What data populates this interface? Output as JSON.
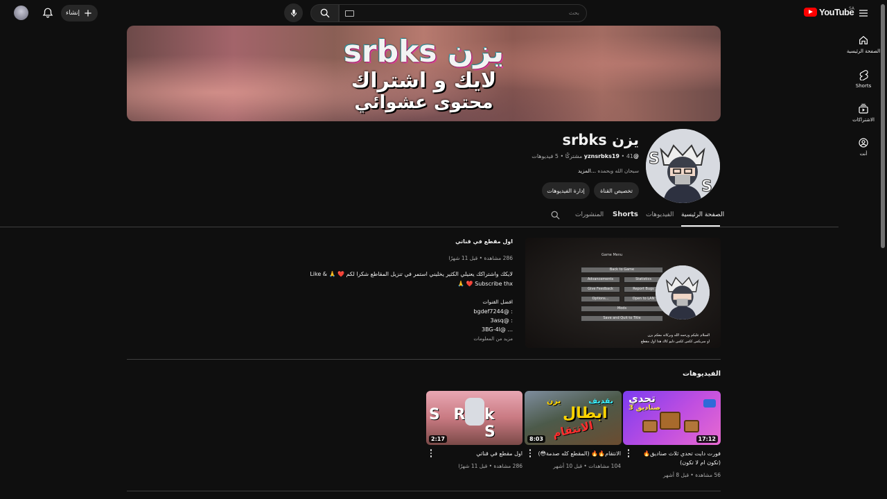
{
  "topbar": {
    "logo_text": "YouTube",
    "region": "SA",
    "search_placeholder": "بحث",
    "create_label": "إنشاء"
  },
  "sidebar": {
    "items": [
      {
        "label": "الصفحة الرئيسية",
        "icon": "home-icon"
      },
      {
        "label": "Shorts",
        "icon": "shorts-icon"
      },
      {
        "label": "الاشتراكات",
        "icon": "subscriptions-icon"
      },
      {
        "label": "أنت",
        "icon": "you-icon"
      }
    ]
  },
  "banner": {
    "line1": "srbks يزن",
    "line2": "لايك و اشتراك",
    "line3": "محتوى عشوائي"
  },
  "channel": {
    "name": "يزن srbks",
    "handle": "@yznsrbks19",
    "subscribers": "41 مشتركًا",
    "videos_count": "5 فيديوهات",
    "stats_sep": "•",
    "description": "سبحان الله وبحمده",
    "more": "...المزيد",
    "customize_label": "تخصيص القناة",
    "manage_label": "إدارة الفيديوهات"
  },
  "tabs": [
    "الصفحة الرئيسية",
    "الفيديوهات",
    "Shorts",
    "المنشورات"
  ],
  "featured": {
    "title": "اول مقطع في قناتي",
    "meta": "286 مشاهدة • قبل 11 شهرًا",
    "desc_line1": "لايكك واشتراكك يعنيلي الكثير يخليني استمر في تنزيل المقاطع شكرا لكم ❤️ 🙏 & Like",
    "desc_line2": "Subscribe thx ❤️ 🙏",
    "best_channels": "افضل القنوات",
    "channel1": "bgdef7244@ :",
    "channel2": "3asq@ :",
    "channel3": "3BG-4l@ ...",
    "more_info": "مزيد من المعلومات",
    "thumb_menu_title": "Game Menu",
    "thumb_menu": [
      "Back to Game",
      "Advancements",
      "Statistics",
      "Give Feedback",
      "Report Bugs",
      "Options...",
      "Open to LAN",
      "Mods",
      "Save and Quit to Title"
    ],
    "thumb_caption1": "السلام عليكم ورحمه الله وبركاته معكم يزن",
    "thumb_caption2": "او سربكس ككس ككس دليو كاك هذا اول مقطع"
  },
  "videos_section": {
    "title": "الفيديوهات",
    "videos": [
      {
        "title_line1": "فورت دايت تحدي ثلاث صناديق🔥",
        "title_line2": "(تكون ام لا تكون)",
        "meta": "56 مشاهدة • قبل 8 أشهر",
        "duration": "17:12",
        "thumb_text1": "تحدي",
        "thumb_text2": "صناديق 3"
      },
      {
        "title_line1": "الانتقام🔥🔥 (المقطع كله صدمة😳)",
        "title_line2": "",
        "meta": "104 مشاهدات • قبل 10 أشهر",
        "duration": "8:03",
        "thumb_text1": "بقديف",
        "thumb_text2": "يزن",
        "thumb_text3": "ابطال",
        "thumb_text4": "الانتقام"
      },
      {
        "title_line1": "اول مقطع في قناتي",
        "title_line2": "",
        "meta": "286 مشاهدة • قبل 11 شهرًا",
        "duration": "2:17",
        "thumb_text1": "S R",
        "thumb_text2": "k S"
      }
    ]
  },
  "colors": {
    "background": "#0f0f0f",
    "youtube_red": "#ff0000",
    "pill": "#272727"
  }
}
